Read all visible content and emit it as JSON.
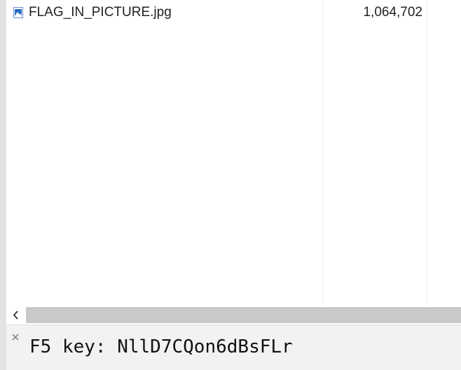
{
  "file_list": {
    "files": [
      {
        "name": "FLAG_IN_PICTURE.jpg",
        "size": "1,064,702",
        "icon": "image-file-icon"
      }
    ]
  },
  "scrollbar": {
    "left_arrow": "‹"
  },
  "find_bar": {
    "text": "F5 key: NllD7CQon6dBsFLr",
    "close_icon": "close-icon"
  },
  "colors": {
    "scroll_thumb": "#c9c9c9",
    "find_bar_bg": "#f2f2f2",
    "gutter": "#e3e3e3",
    "icon_blue": "#2b6cc4"
  }
}
